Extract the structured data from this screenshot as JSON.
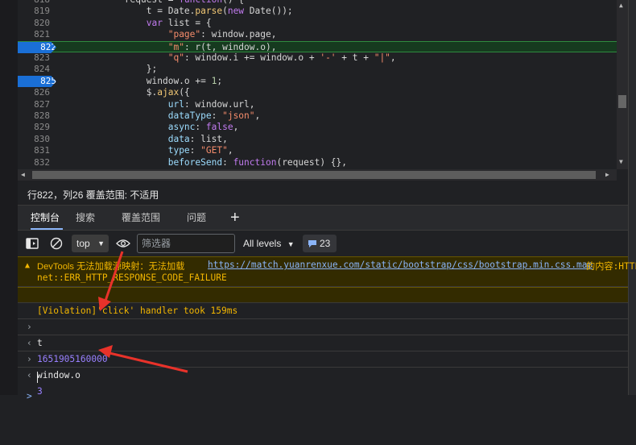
{
  "editor": {
    "lines": [
      {
        "n": "818",
        "segs": [
          {
            "t": "            request = ",
            "c": ""
          },
          {
            "t": "function",
            "c": "kw"
          },
          {
            "t": "() {",
            "c": ""
          }
        ]
      },
      {
        "n": "819",
        "segs": [
          {
            "t": "                t = Date.",
            "c": ""
          },
          {
            "t": "parse",
            "c": "fn"
          },
          {
            "t": "(",
            "c": ""
          },
          {
            "t": "new",
            "c": "kw"
          },
          {
            "t": " Date());",
            "c": ""
          }
        ]
      },
      {
        "n": "820",
        "segs": [
          {
            "t": "                ",
            "c": ""
          },
          {
            "t": "var",
            "c": "kw"
          },
          {
            "t": " list = {",
            "c": ""
          }
        ]
      },
      {
        "n": "821",
        "segs": [
          {
            "t": "                    ",
            "c": ""
          },
          {
            "t": "\"page\"",
            "c": "str"
          },
          {
            "t": ": window.page,",
            "c": ""
          }
        ]
      },
      {
        "n": "822",
        "bp": true,
        "exec": true,
        "segs": [
          {
            "t": "                    ",
            "c": ""
          },
          {
            "t": "\"m\"",
            "c": "str"
          },
          {
            "t": ": r(t, window.o),",
            "c": ""
          }
        ]
      },
      {
        "n": "823",
        "segs": [
          {
            "t": "                    ",
            "c": ""
          },
          {
            "t": "\"q\"",
            "c": "str"
          },
          {
            "t": ": window.i += window.o + ",
            "c": ""
          },
          {
            "t": "'-'",
            "c": "str"
          },
          {
            "t": " + t + ",
            "c": ""
          },
          {
            "t": "\"|\"",
            "c": "str"
          },
          {
            "t": ",",
            "c": ""
          }
        ]
      },
      {
        "n": "824",
        "segs": [
          {
            "t": "                };",
            "c": ""
          }
        ]
      },
      {
        "n": "825",
        "bp": true,
        "segs": [
          {
            "t": "                window.o += ",
            "c": ""
          },
          {
            "t": "1",
            "c": "num"
          },
          {
            "t": ";",
            "c": ""
          }
        ]
      },
      {
        "n": "826",
        "segs": [
          {
            "t": "                $.",
            "c": ""
          },
          {
            "t": "ajax",
            "c": "fn"
          },
          {
            "t": "({",
            "c": ""
          }
        ]
      },
      {
        "n": "827",
        "segs": [
          {
            "t": "                    ",
            "c": ""
          },
          {
            "t": "url",
            "c": "prop"
          },
          {
            "t": ": window.url,",
            "c": ""
          }
        ]
      },
      {
        "n": "828",
        "segs": [
          {
            "t": "                    ",
            "c": ""
          },
          {
            "t": "dataType",
            "c": "prop"
          },
          {
            "t": ": ",
            "c": ""
          },
          {
            "t": "\"json\"",
            "c": "str"
          },
          {
            "t": ",",
            "c": ""
          }
        ]
      },
      {
        "n": "829",
        "segs": [
          {
            "t": "                    ",
            "c": ""
          },
          {
            "t": "async",
            "c": "prop"
          },
          {
            "t": ": ",
            "c": ""
          },
          {
            "t": "false",
            "c": "kw"
          },
          {
            "t": ",",
            "c": ""
          }
        ]
      },
      {
        "n": "830",
        "segs": [
          {
            "t": "                    ",
            "c": ""
          },
          {
            "t": "data",
            "c": "prop"
          },
          {
            "t": ": list,",
            "c": ""
          }
        ]
      },
      {
        "n": "831",
        "segs": [
          {
            "t": "                    ",
            "c": ""
          },
          {
            "t": "type",
            "c": "prop"
          },
          {
            "t": ": ",
            "c": ""
          },
          {
            "t": "\"GET\"",
            "c": "str"
          },
          {
            "t": ",",
            "c": ""
          }
        ]
      },
      {
        "n": "832",
        "segs": [
          {
            "t": "                    ",
            "c": ""
          },
          {
            "t": "beforeSend",
            "c": "prop"
          },
          {
            "t": ": ",
            "c": ""
          },
          {
            "t": "function",
            "c": "kw"
          },
          {
            "t": "(request) {},",
            "c": ""
          }
        ]
      }
    ]
  },
  "status": {
    "text": "行822，列26   覆盖范围: 不适用"
  },
  "tabs": [
    {
      "label": "控制台",
      "active": true
    },
    {
      "label": "搜索"
    },
    {
      "label": "覆盖范围"
    },
    {
      "label": "问题"
    }
  ],
  "tabs_add": "+",
  "toolbar": {
    "context": "top",
    "filter_placeholder": "筛选器",
    "levels": "All levels",
    "issues_count": "23"
  },
  "console": {
    "warning": {
      "prefix": "DevTools 无法加载源映射：无法加载",
      "url": "https://match.yuanrenxue.com/static/bootstrap/css/bootstrap.min.css.map",
      "suffix": "的内容:HTTP",
      "line2": "net::ERR_HTTP_RESPONSE_CODE_FAILURE"
    },
    "violation": "[Violation]'click' handler took 159ms",
    "entries": [
      {
        "input": "t",
        "output": "1651905160000"
      },
      {
        "input": "window.o",
        "output": "3"
      }
    ],
    "prompt": ">"
  },
  "colors": {
    "accent": "#8ab4f8",
    "breakpoint": "#1a6fd6",
    "exec_line": "#163a1f",
    "warning_bg": "#332b00",
    "annotation": "#e8322a"
  }
}
